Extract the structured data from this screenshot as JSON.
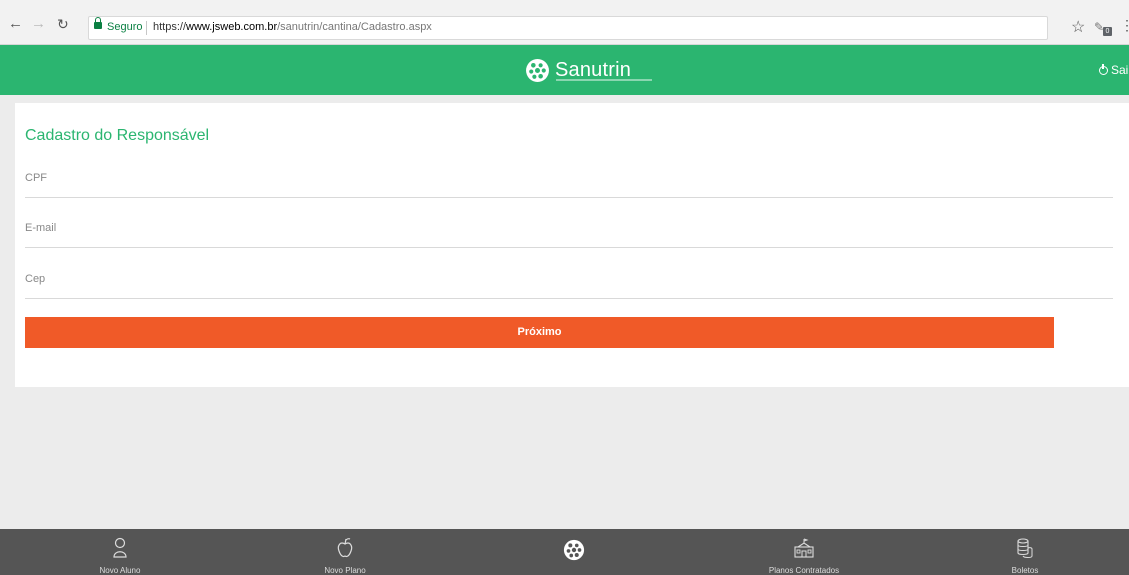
{
  "browser": {
    "back_icon": "arrow-left-icon",
    "forward_icon": "arrow-right-icon",
    "reload_icon": "reload-icon",
    "secure_label": "Seguro",
    "url_scheme": "https://",
    "url_host": "www.jsweb.com.br",
    "url_path": "/sanutrin/cantina/Cadastro.aspx",
    "extension_badge": "0"
  },
  "header": {
    "brand": "Sanutrin",
    "logout_label": "Sai"
  },
  "form": {
    "title": "Cadastro do Responsável",
    "fields": [
      {
        "placeholder": "CPF",
        "value": ""
      },
      {
        "placeholder": "E-mail",
        "value": ""
      },
      {
        "placeholder": "Cep",
        "value": ""
      }
    ],
    "next_label": "Próximo"
  },
  "bottom_nav": [
    {
      "label": "Novo Aluno",
      "icon": "person-icon"
    },
    {
      "label": "Novo Plano",
      "icon": "apple-icon"
    },
    {
      "label": "",
      "icon": "sanutrin-logo-icon"
    },
    {
      "label": "Planos Contratados",
      "icon": "school-icon"
    },
    {
      "label": "Boletos",
      "icon": "coins-icon"
    }
  ],
  "colors": {
    "brand_green": "#2bb570",
    "action_orange": "#f05a28",
    "nav_gray": "#555555",
    "page_bg": "#ececec"
  }
}
